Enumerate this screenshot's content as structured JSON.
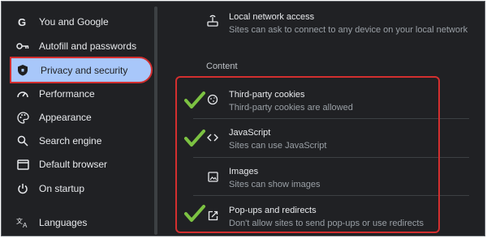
{
  "sidebar": {
    "items": [
      {
        "label": "You and Google",
        "icon": "google-icon"
      },
      {
        "label": "Autofill and passwords",
        "icon": "key-icon"
      },
      {
        "label": "Privacy and security",
        "icon": "shield-icon",
        "active": true
      },
      {
        "label": "Performance",
        "icon": "speedometer-icon"
      },
      {
        "label": "Appearance",
        "icon": "palette-icon"
      },
      {
        "label": "Search engine",
        "icon": "search-icon"
      },
      {
        "label": "Default browser",
        "icon": "browser-window-icon"
      },
      {
        "label": "On startup",
        "icon": "power-icon"
      },
      {
        "label": "Languages",
        "icon": "translate-icon"
      }
    ]
  },
  "main": {
    "local_network": {
      "title": "Local network access",
      "subtitle": "Sites can ask to connect to any device on your local network",
      "icon": "network-device-icon"
    },
    "content_section_label": "Content",
    "content_rows": [
      {
        "title": "Third-party cookies",
        "subtitle": "Third-party cookies are allowed",
        "icon": "cookie-icon"
      },
      {
        "title": "JavaScript",
        "subtitle": "Sites can use JavaScript",
        "icon": "code-brackets-icon"
      },
      {
        "title": "Images",
        "subtitle": "Sites can show images",
        "icon": "image-icon"
      },
      {
        "title": "Pop-ups and redirects",
        "subtitle": "Don't allow sites to send pop-ups or use redirects",
        "icon": "external-link-icon"
      }
    ]
  },
  "colors": {
    "background": "#202124",
    "active_item": "#a8c7fa",
    "highlight_outline": "#d32f2f",
    "checkmark": "#7cc242"
  }
}
